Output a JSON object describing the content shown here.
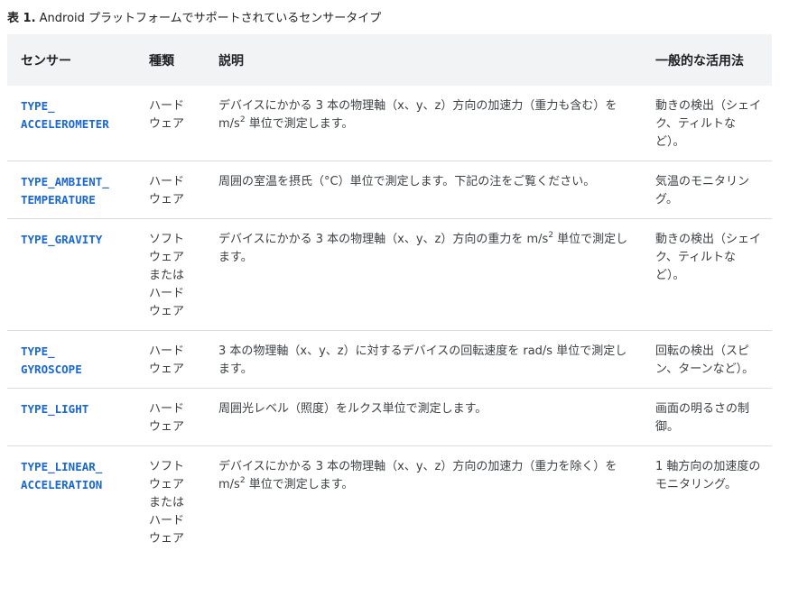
{
  "caption": {
    "label": "表 1.",
    "text": " Android プラットフォームでサポートされているセンサータイプ"
  },
  "table": {
    "headers": {
      "sensor": "センサー",
      "type": "種類",
      "description": "説明",
      "common_uses": "一般的な活用法"
    },
    "rows": [
      {
        "sensor_parts": [
          "TYPE_",
          "ACCELEROMETER"
        ],
        "type": "ハード\nウェア",
        "desc_before": "デバイスにかかる 3 本の物理軸（x、y、z）方向の加速力（重力も含む）を m/s",
        "desc_sup": "2",
        "desc_after": " 単位で測定します。",
        "uses": "動きの検出（シェイク、ティルトなど）。"
      },
      {
        "sensor_parts": [
          "TYPE_AMBIENT_",
          "TEMPERATURE"
        ],
        "type": "ハード\nウェア",
        "desc_before": "周囲の室温を摂氏（°C）単位で測定します。下記の注をご覧ください。",
        "desc_sup": "",
        "desc_after": "",
        "uses": "気温のモニタリング。"
      },
      {
        "sensor_parts": [
          "TYPE_GRAVITY"
        ],
        "type": "ソフト\nウェア\nまたは\nハード\nウェア",
        "desc_before": "デバイスにかかる 3 本の物理軸（x、y、z）方向の重力を m/s",
        "desc_sup": "2",
        "desc_after": " 単位で測定します。",
        "uses": "動きの検出（シェイク、ティルトなど）。"
      },
      {
        "sensor_parts": [
          "TYPE_",
          "GYROSCOPE"
        ],
        "type": "ハード\nウェア",
        "desc_before": "3 本の物理軸（x、y、z）に対するデバイスの回転速度を rad/s 単位で測定します。",
        "desc_sup": "",
        "desc_after": "",
        "uses": "回転の検出（スピン、ターンなど）。"
      },
      {
        "sensor_parts": [
          "TYPE_LIGHT"
        ],
        "type": "ハード\nウェア",
        "desc_before": "周囲光レベル（照度）をルクス単位で測定します。",
        "desc_sup": "",
        "desc_after": "",
        "uses": "画面の明るさの制御。"
      },
      {
        "sensor_parts": [
          "TYPE_LINEAR_",
          "ACCELERATION"
        ],
        "type": "ソフト\nウェア\nまたは\nハード\nウェア",
        "desc_before": "デバイスにかかる 3 本の物理軸（x、y、z）方向の加速力（重力を除く）を m/s",
        "desc_sup": "2",
        "desc_after": " 単位で測定します。",
        "uses": "1 軸方向の加速度のモニタリング。"
      }
    ]
  }
}
